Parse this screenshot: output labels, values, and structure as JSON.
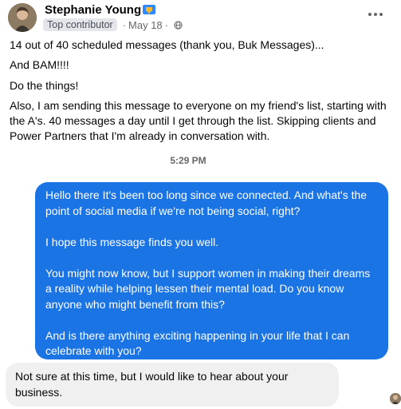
{
  "post": {
    "author_name": "Stephanie Young",
    "contributor_badge": "Top contributor",
    "date": "May 18",
    "separator": "·",
    "paragraphs": [
      "14 out of 40 scheduled messages (thank you, Buk Messages)...",
      "And BAM!!!!",
      "Do the things!",
      "Also, I am sending this message to everyone on my friend's list, starting with the A's. 40 messages a day until I get through the list. Skipping clients and Power Partners that I'm already in conversation with."
    ]
  },
  "chat": {
    "timestamp": "5:29 PM",
    "outgoing_message": {
      "line1": "Hello there It's been too long since we connected. And what's the point of social media if we're not being social, right?",
      "line2": "I hope this message finds you well.",
      "line3": "You might now know, but I support women in making their dreams a reality while helping lessen their mental load. Do you know anyone who might benefit from this?",
      "line4": "And is there anything exciting happening in your life that I can celebrate with you?"
    },
    "incoming_message": "Not sure at this time, but I would like to hear about your business."
  },
  "colors": {
    "outgoing_bubble": "#1b74e4",
    "incoming_bubble": "#f0f0f0",
    "secondary_text": "#65676b"
  },
  "icons": {
    "author_badge": "contributor-trophy-icon",
    "audience": "globe-icon",
    "more": "more-options-icon"
  }
}
